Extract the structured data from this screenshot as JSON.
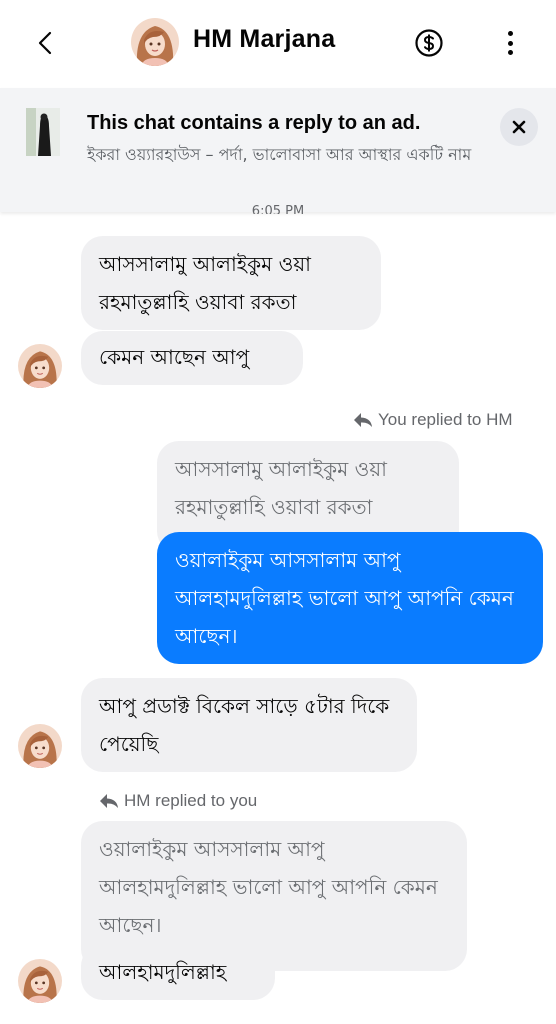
{
  "header": {
    "contact_name": "HM Marjana",
    "icons": [
      "back-arrow-icon",
      "avatar",
      "dollar-circle-icon",
      "more-vertical-icon"
    ]
  },
  "ad_banner": {
    "title": "This chat contains a reply to an ad.",
    "subtitle": "ইকরা ওয়্যারহাউস – পর্দা, ভালোবাসা আর আস্থার একটি নাম",
    "close_icon": "close-icon"
  },
  "timestamp": "6:05 PM",
  "messages": {
    "in1": "আসসালামু আলাইকুম ওয়া রহমাতুল্লাহি ওয়াবা রকতা",
    "in2": "কেমন আছেন আপু",
    "reply_note_out": "You replied to HM",
    "quoted_out": "আসসালামু আলাইকুম ওয়া রহমাতুল্লাহি ওয়াবা রকতা",
    "out1": "ওয়ালাইকুম আসসালাম আপু আলহামদুলিল্লাহ ভালো আপু আপনি কেমন আছেন।",
    "in3": "আপু প্রডাক্ট বিকেল সাড়ে ৫টার দিকে পেয়েছি",
    "reply_note_in": "HM replied to you",
    "quoted_in": "ওয়ালাইকুম আসসালাম আপু আলহামদুলিল্লাহ ভালো আপু আপনি কেমন আছেন।",
    "in4": "আলহামদুলিল্লাহ"
  },
  "colors": {
    "accent": "#0a7cff",
    "incoming_bubble": "#f0f0f2",
    "banner_bg": "#f3f4f6"
  }
}
